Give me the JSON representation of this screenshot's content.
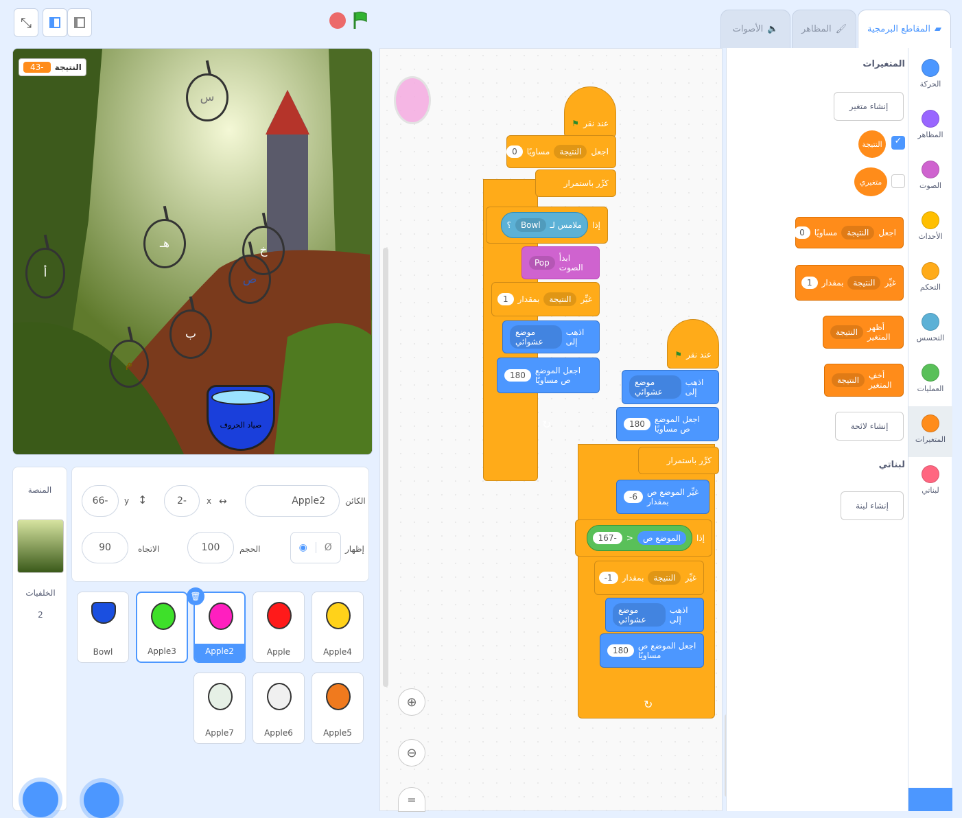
{
  "controls": {
    "fullscreen_icon": "fullscreen-icon",
    "small_stage_icon": "small-stage-icon",
    "large_stage_icon": "large-stage-icon"
  },
  "stage": {
    "score_label": "النتيجة",
    "score_value": "43-",
    "apples": [
      {
        "letter": "س",
        "color": "#f0f0f0"
      },
      {
        "letter": "هـ",
        "color": "#f07a1e"
      },
      {
        "letter": "خ",
        "color": "#3ee02a"
      },
      {
        "letter": "ص",
        "color": "#e6f0e6"
      },
      {
        "letter": "أ",
        "color": "#ff1a1a"
      },
      {
        "letter": "ب",
        "color": "#ff1fbf"
      },
      {
        "letter": "م",
        "color": "#ffd21a"
      }
    ],
    "bowl_label": "صياد الحروف"
  },
  "sprite_info": {
    "sprite_label": "الكائن",
    "sprite_name": "Apple2",
    "x_label": "x",
    "x_value": "2-",
    "y_label": "y",
    "y_value": "66-",
    "show_label": "إظهار",
    "size_label": "الحجم",
    "size_value": "100",
    "direction_label": "الاتجاه",
    "direction_value": "90"
  },
  "sprites": [
    {
      "name": "Bowl",
      "color": "#1a4fe0"
    },
    {
      "name": "Apple3",
      "color": "#3ee02a",
      "letter": "خ"
    },
    {
      "name": "Apple2",
      "color": "#ff1fbf",
      "letter": "ب",
      "selected": true
    },
    {
      "name": "Apple",
      "color": "#ff1a1a",
      "letter": "أ"
    },
    {
      "name": "Apple4",
      "color": "#ffd21a",
      "letter": "م"
    },
    {
      "name": "Apple7",
      "color": "#e6f0e6",
      "letter": "ص"
    },
    {
      "name": "Apple6",
      "color": "#f0f0f0",
      "letter": "س"
    },
    {
      "name": "Apple5",
      "color": "#f07a1e",
      "letter": "هـ"
    }
  ],
  "stage_panel": {
    "title": "المنصة",
    "backdrops_label": "الخلفيات",
    "backdrops_count": "2"
  },
  "tabs": {
    "code": "المقاطع البرمجية",
    "costumes": "المظاهر",
    "sounds": "الأصوات"
  },
  "categories": [
    {
      "label": "الحركة",
      "color": "#4c97ff"
    },
    {
      "label": "المظاهر",
      "color": "#9966ff"
    },
    {
      "label": "الصوت",
      "color": "#cf63cf"
    },
    {
      "label": "الأحداث",
      "color": "#ffbf00"
    },
    {
      "label": "التحكم",
      "color": "#ffab19"
    },
    {
      "label": "التحسس",
      "color": "#5cb1d6"
    },
    {
      "label": "العمليات",
      "color": "#59c059"
    },
    {
      "label": "المتغيرات",
      "color": "#ff8c1a"
    },
    {
      "label": "لبناتي",
      "color": "#ff6680"
    }
  ],
  "palette": {
    "section_vars": "المتغيرات",
    "make_var": "إنشاء متغير",
    "var1": "النتيجة",
    "var2": "متغيري",
    "set_block": {
      "label": "اجعل",
      "var": "النتيجة",
      "mid": "مساويًا",
      "value": "0"
    },
    "change_block": {
      "label": "غيِّر",
      "var": "النتيجة",
      "mid": "بمقدار",
      "value": "1"
    },
    "show_var": {
      "label": "أظهر المتغير",
      "var": "النتيجة"
    },
    "hide_var": {
      "label": "أخفِ المتغير",
      "var": "النتيجة"
    },
    "make_list": "إنشاء لائحة",
    "section_my": "لبناتي",
    "make_block": "إنشاء لبنة"
  },
  "script1": {
    "hat": "عند نقر",
    "set": {
      "label": "اجعل",
      "var": "النتيجة",
      "mid": "مساويًا",
      "value": "0"
    },
    "forever": "كرِّر باستمرار",
    "if": "إذا",
    "touching": {
      "label": "ملامس لـ",
      "target": "Bowl",
      "q": "؟"
    },
    "play": {
      "label": "ابدأ الصوت",
      "sound": "Pop"
    },
    "change": {
      "label": "غيِّر",
      "var": "النتيجة",
      "mid": "بمقدار",
      "value": "1"
    },
    "goto": {
      "label": "اذهب إلى",
      "target": "موضع عشوائي"
    },
    "sety": {
      "label": "اجعل الموضع ص مساويًا",
      "value": "180"
    }
  },
  "script2": {
    "hat": "عند نقر",
    "goto": {
      "label": "اذهب إلى",
      "target": "موضع عشوائي"
    },
    "sety": {
      "label": "اجعل الموضع ص مساويًا",
      "value": "180"
    },
    "forever": "كرِّر باستمرار",
    "changey": {
      "label": "غيِّر الموضع ص بمقدار",
      "value": "-6"
    },
    "if": "إذا",
    "cond": {
      "left": "الموضع ص",
      "op": ">",
      "right": "167-"
    },
    "change": {
      "label": "غيِّر",
      "var": "النتيجة",
      "mid": "بمقدار",
      "value": "-1"
    },
    "goto2": {
      "label": "اذهب إلى",
      "target": "موضع عشوائي"
    },
    "sety2": {
      "label": "اجعل الموضع ص مساويًا",
      "value": "180"
    }
  }
}
